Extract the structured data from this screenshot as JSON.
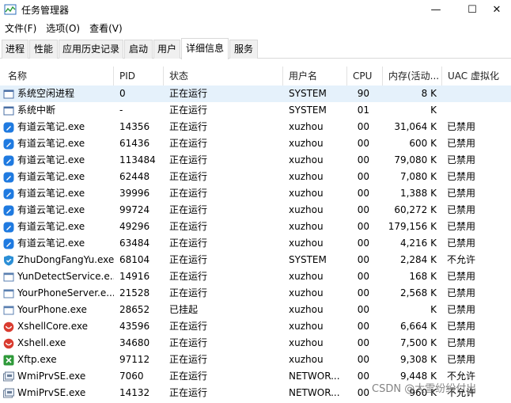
{
  "window": {
    "title": "任务管理器",
    "minimize": "—",
    "maximize": "☐",
    "close": "✕"
  },
  "menu": [
    "文件(F)",
    "选项(O)",
    "查看(V)"
  ],
  "tabs": [
    "进程",
    "性能",
    "应用历史记录",
    "启动",
    "用户",
    "详细信息",
    "服务"
  ],
  "active_tab": "详细信息",
  "columns": {
    "name": "名称",
    "pid": "PID",
    "status": "状态",
    "user": "用户名",
    "cpu": "CPU",
    "mem": "内存(活动...",
    "uac": "UAC 虚拟化"
  },
  "rows": [
    {
      "icon": "system-idle-icon",
      "name": "系统空闲进程",
      "pid": "0",
      "status": "正在运行",
      "user": "SYSTEM",
      "cpu": "90",
      "mem": "8 K",
      "uac": ""
    },
    {
      "icon": "system-interrupt-icon",
      "name": "系统中断",
      "pid": "-",
      "status": "正在运行",
      "user": "SYSTEM",
      "cpu": "01",
      "mem": "K",
      "uac": ""
    },
    {
      "icon": "youdao-note-icon",
      "name": "有道云笔记.exe",
      "pid": "14356",
      "status": "正在运行",
      "user": "xuzhou",
      "cpu": "00",
      "mem": "31,064 K",
      "uac": "已禁用"
    },
    {
      "icon": "youdao-note-icon",
      "name": "有道云笔记.exe",
      "pid": "61436",
      "status": "正在运行",
      "user": "xuzhou",
      "cpu": "00",
      "mem": "600 K",
      "uac": "已禁用"
    },
    {
      "icon": "youdao-note-icon",
      "name": "有道云笔记.exe",
      "pid": "113484",
      "status": "正在运行",
      "user": "xuzhou",
      "cpu": "00",
      "mem": "79,080 K",
      "uac": "已禁用"
    },
    {
      "icon": "youdao-note-icon",
      "name": "有道云笔记.exe",
      "pid": "62448",
      "status": "正在运行",
      "user": "xuzhou",
      "cpu": "00",
      "mem": "7,080 K",
      "uac": "已禁用"
    },
    {
      "icon": "youdao-note-icon",
      "name": "有道云笔记.exe",
      "pid": "39996",
      "status": "正在运行",
      "user": "xuzhou",
      "cpu": "00",
      "mem": "1,388 K",
      "uac": "已禁用"
    },
    {
      "icon": "youdao-note-icon",
      "name": "有道云笔记.exe",
      "pid": "99724",
      "status": "正在运行",
      "user": "xuzhou",
      "cpu": "00",
      "mem": "60,272 K",
      "uac": "已禁用"
    },
    {
      "icon": "youdao-note-icon",
      "name": "有道云笔记.exe",
      "pid": "49296",
      "status": "正在运行",
      "user": "xuzhou",
      "cpu": "00",
      "mem": "179,156 K",
      "uac": "已禁用"
    },
    {
      "icon": "youdao-note-icon",
      "name": "有道云笔记.exe",
      "pid": "63484",
      "status": "正在运行",
      "user": "xuzhou",
      "cpu": "00",
      "mem": "4,216 K",
      "uac": "已禁用"
    },
    {
      "icon": "shield-icon",
      "name": "ZhuDongFangYu.exe",
      "pid": "68104",
      "status": "正在运行",
      "user": "SYSTEM",
      "cpu": "00",
      "mem": "2,284 K",
      "uac": "不允许"
    },
    {
      "icon": "app-window-icon",
      "name": "YunDetectService.e...",
      "pid": "14916",
      "status": "正在运行",
      "user": "xuzhou",
      "cpu": "00",
      "mem": "168 K",
      "uac": "已禁用"
    },
    {
      "icon": "app-window-icon",
      "name": "YourPhoneServer.e...",
      "pid": "21528",
      "status": "正在运行",
      "user": "xuzhou",
      "cpu": "00",
      "mem": "2,568 K",
      "uac": "已禁用"
    },
    {
      "icon": "app-window-icon",
      "name": "YourPhone.exe",
      "pid": "28652",
      "status": "已挂起",
      "user": "xuzhou",
      "cpu": "00",
      "mem": "K",
      "uac": "已禁用"
    },
    {
      "icon": "xshell-icon",
      "name": "XshellCore.exe",
      "pid": "43596",
      "status": "正在运行",
      "user": "xuzhou",
      "cpu": "00",
      "mem": "6,664 K",
      "uac": "已禁用"
    },
    {
      "icon": "xshell-icon",
      "name": "Xshell.exe",
      "pid": "34680",
      "status": "正在运行",
      "user": "xuzhou",
      "cpu": "00",
      "mem": "7,500 K",
      "uac": "已禁用"
    },
    {
      "icon": "xftp-icon",
      "name": "Xftp.exe",
      "pid": "97112",
      "status": "正在运行",
      "user": "xuzhou",
      "cpu": "00",
      "mem": "9,308 K",
      "uac": "已禁用"
    },
    {
      "icon": "wmi-icon",
      "name": "WmiPrvSE.exe",
      "pid": "7060",
      "status": "正在运行",
      "user": "NETWOR...",
      "cpu": "00",
      "mem": "9,448 K",
      "uac": "不允许"
    },
    {
      "icon": "wmi-icon",
      "name": "WmiPrvSE.exe",
      "pid": "14132",
      "status": "正在运行",
      "user": "NETWOR...",
      "cpu": "00",
      "mem": "960 K",
      "uac": "不允许"
    }
  ],
  "watermark": "CSDN @大雪纷纷付出",
  "colors": {
    "selected_row": "#e5f1fb",
    "youdao_blue": "#1f7ae0",
    "xshell_red": "#d93b2f",
    "xftp_green": "#2f9a3a",
    "shield_blue": "#2b8fd6"
  }
}
